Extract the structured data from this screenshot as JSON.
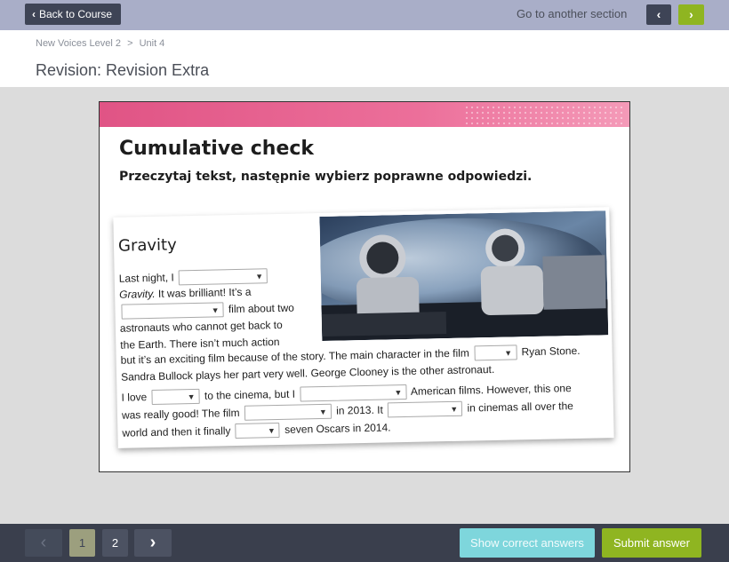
{
  "topbar": {
    "back_label": "Back to Course",
    "goto_label": "Go to another section"
  },
  "header": {
    "breadcrumbs": [
      "New Voices Level 2",
      ">",
      "Unit 4"
    ],
    "title": "Revision: Revision Extra"
  },
  "activity": {
    "title": "Cumulative check",
    "instruction": "Przeczytaj tekst, następnie wybierz poprawne odpowiedzi.",
    "article_title": "Gravity",
    "lines": [
      "Last night, I",
      "Gravity.",
      "It was brilliant! It’s a",
      "film about two",
      "astronauts who cannot get back to",
      "the Earth. There isn’t much action",
      "but it’s an exciting film because of the story. The main character in the film",
      "Ryan Stone.",
      "Sandra Bullock plays her part very well. George Clooney is the other astronaut.",
      "I love",
      "to the cinema, but I",
      "American films. However, this one",
      "was really good! The film",
      "in 2013. It",
      "in cinemas all over the",
      "world and then it finally",
      "seven Oscars in 2014."
    ]
  },
  "footer": {
    "pages": [
      "1",
      "2"
    ],
    "current_page": "1",
    "show_answers_label": "Show correct answers",
    "submit_label": "Submit answer"
  },
  "colors": {
    "topbar": "#a9aec8",
    "dark_button": "#3e4456",
    "green": "#8fb521",
    "pink": "#e05485",
    "teal": "#7ed6dc",
    "footer": "#3a3f4d"
  }
}
